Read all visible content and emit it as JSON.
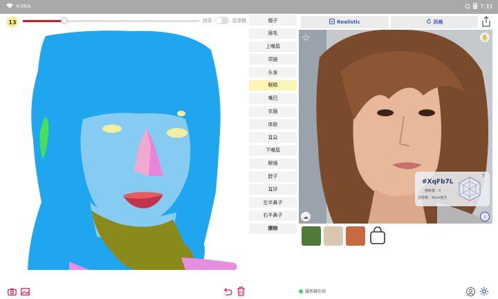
{
  "status_bar": {
    "carrier_note": "4.0K/s",
    "time": "7:33",
    "battery_icon": "battery-icon"
  },
  "toolbar": {
    "brush_size": "13",
    "brush_level": 0.23,
    "mode_left": "线条",
    "mode_right": "油漆桶"
  },
  "labels": [
    {
      "text": "帽子",
      "color": "#f3f3f3"
    },
    {
      "text": "眉毛",
      "color": "#f3f3f3"
    },
    {
      "text": "上嘴唇",
      "color": "#f3f3f3"
    },
    {
      "text": "项链",
      "color": "#f3f3f3"
    },
    {
      "text": "头发",
      "color": "#f3f3f3"
    },
    {
      "text": "眼睛",
      "color": "#fbf6b4"
    },
    {
      "text": "嘴巴",
      "color": "#f3f3f3"
    },
    {
      "text": "衣服",
      "color": "#f3f3f3"
    },
    {
      "text": "体肤",
      "color": "#f3f3f3"
    },
    {
      "text": "耳朵",
      "color": "#f3f3f3"
    },
    {
      "text": "下嘴唇",
      "color": "#f3f3f3"
    },
    {
      "text": "眼镜",
      "color": "#f3f3f3"
    },
    {
      "text": "脖子",
      "color": "#f3f3f3"
    },
    {
      "text": "耳环",
      "color": "#f3f3f3"
    },
    {
      "text": "左半鼻子",
      "color": "#f3f3f3"
    },
    {
      "text": "右半鼻子",
      "color": "#f3f3f3"
    },
    {
      "text": "擦除",
      "color": "#f3f3f3"
    }
  ],
  "result_panel": {
    "realistic_label": "Realistic",
    "style_label": "风格",
    "card": {
      "id": "#XqFb7L",
      "line1": "拥有者：0",
      "line2": "创造者：Wuxi官方"
    }
  },
  "bottom": {
    "server_status": "服务器在线",
    "accent_color": "#d6235f"
  }
}
